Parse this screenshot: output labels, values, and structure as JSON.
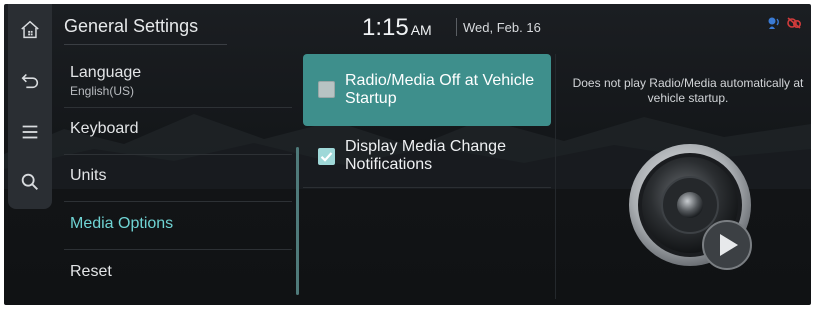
{
  "header": {
    "title": "General Settings",
    "time": "1:15",
    "ampm": "AM",
    "date": "Wed, Feb. 16"
  },
  "rail": {
    "icons": [
      "home-icon",
      "back-icon",
      "menu-icon",
      "search-icon"
    ]
  },
  "menu": {
    "items": [
      {
        "label": "Language",
        "sub": "English(US)"
      },
      {
        "label": "Keyboard"
      },
      {
        "label": "Units"
      },
      {
        "label": "Media Options",
        "active": true
      },
      {
        "label": "Reset"
      }
    ]
  },
  "options": [
    {
      "label": "Radio/Media Off at Vehicle Startup",
      "checked": false,
      "selected": true
    },
    {
      "label": "Display Media Change Notifications",
      "checked": true,
      "selected": false
    }
  ],
  "description": "Does not play Radio/Media automatically at vehicle startup.",
  "colors": {
    "accent": "#3e8f8c",
    "active_text": "#6fd3d3",
    "background": "#15181b",
    "status_blue": "#3a7bd5",
    "status_red": "#d13b3b"
  }
}
